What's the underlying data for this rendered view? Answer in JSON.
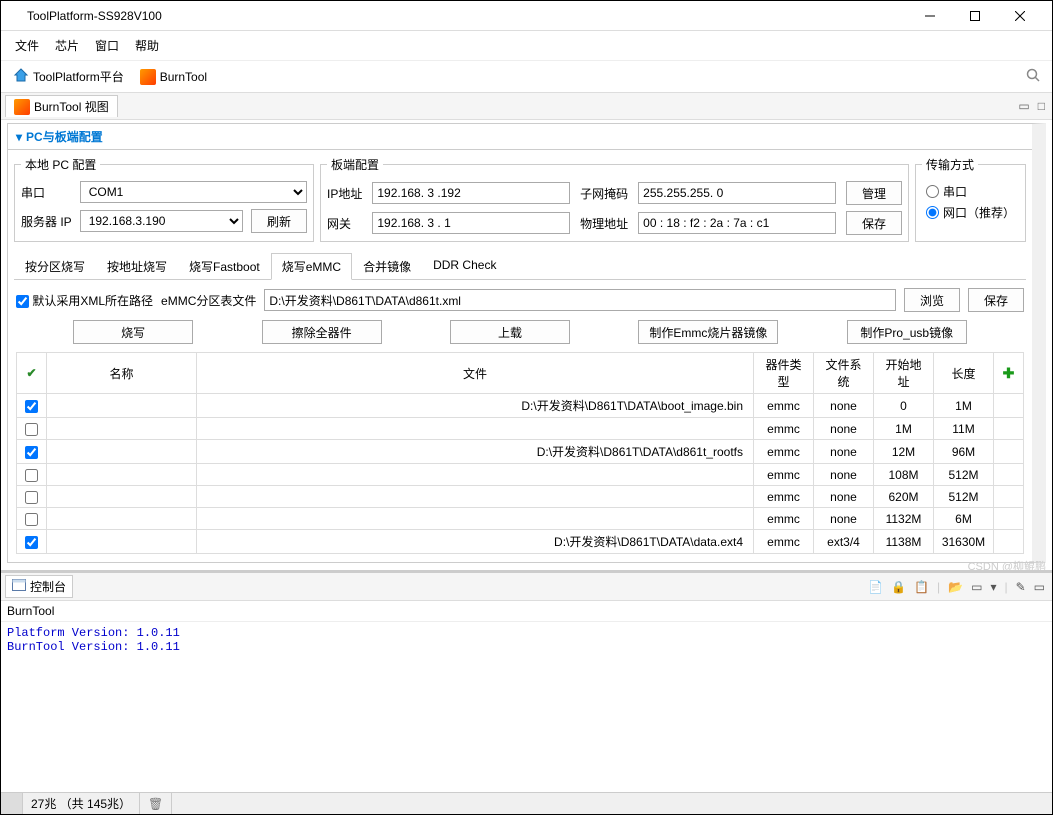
{
  "window": {
    "title": "ToolPlatform-SS928V100"
  },
  "menu": {
    "file": "文件",
    "chip": "芯片",
    "window": "窗口",
    "help": "帮助"
  },
  "toolbar": {
    "platform": "ToolPlatform平台",
    "burntool": "BurnTool"
  },
  "viewtab": {
    "label": "BurnTool 视图"
  },
  "accordion": {
    "title": "PC与板端配置"
  },
  "pc": {
    "legend": "本地 PC 配置",
    "serial_label": "串口",
    "serial_value": "COM1",
    "server_label": "服务器 IP",
    "server_value": "192.168.3.190",
    "refresh": "刷新"
  },
  "board": {
    "legend": "板端配置",
    "ip_label": "IP地址",
    "ip_value": "192.168. 3 .192",
    "gw_label": "网关",
    "gw_value": "192.168. 3 . 1",
    "mask_label": "子网掩码",
    "mask_value": "255.255.255. 0",
    "mac_label": "物理地址",
    "mac_value": "00 : 18 : f2 : 2a : 7a : c1",
    "manage": "管理",
    "save": "保存"
  },
  "transfer": {
    "legend": "传输方式",
    "serial": "串口",
    "net": "网口（推荐）"
  },
  "tabs": {
    "t0": "按分区烧写",
    "t1": "按地址烧写",
    "t2": "烧写Fastboot",
    "t3": "烧写eMMC",
    "t4": "合并镜像",
    "t5": "DDR Check"
  },
  "xmlrow": {
    "chk_label": "默认采用XML所在路径",
    "file_label": "eMMC分区表文件",
    "path": "D:\\开发资料\\D861T\\DATA\\d861t.xml",
    "browse": "浏览",
    "save": "保存"
  },
  "actions": {
    "burn": "烧写",
    "erase": "擦除全器件",
    "upload": "上载",
    "make_emmc": "制作Emmc烧片器镜像",
    "make_pro": "制作Pro_usb镜像"
  },
  "grid": {
    "h_name": "名称",
    "h_file": "文件",
    "h_devtype": "器件类型",
    "h_fs": "文件系统",
    "h_start": "开始地址",
    "h_len": "长度",
    "rows": [
      {
        "chk": true,
        "file": "D:\\开发资料\\D861T\\DATA\\boot_image.bin",
        "dev": "emmc",
        "fs": "none",
        "start": "0",
        "len": "1M"
      },
      {
        "chk": false,
        "file": "",
        "dev": "emmc",
        "fs": "none",
        "start": "1M",
        "len": "11M"
      },
      {
        "chk": true,
        "file": "D:\\开发资料\\D861T\\DATA\\d861t_rootfs",
        "dev": "emmc",
        "fs": "none",
        "start": "12M",
        "len": "96M"
      },
      {
        "chk": false,
        "file": "",
        "dev": "emmc",
        "fs": "none",
        "start": "108M",
        "len": "512M"
      },
      {
        "chk": false,
        "file": "",
        "dev": "emmc",
        "fs": "none",
        "start": "620M",
        "len": "512M"
      },
      {
        "chk": false,
        "file": "",
        "dev": "emmc",
        "fs": "none",
        "start": "1132M",
        "len": "6M"
      },
      {
        "chk": true,
        "file": "D:\\开发资料\\D861T\\DATA\\data.ext4",
        "dev": "emmc",
        "fs": "ext3/4",
        "start": "1138M",
        "len": "31630M"
      }
    ]
  },
  "console": {
    "tab": "控制台",
    "title": "BurnTool",
    "out": "Platform Version: 1.0.11\nBurnTool Version: 1.0.11\n"
  },
  "status": {
    "text": "27兆 （共 145兆）"
  },
  "watermark": "CSDN @柳鲲鹏"
}
